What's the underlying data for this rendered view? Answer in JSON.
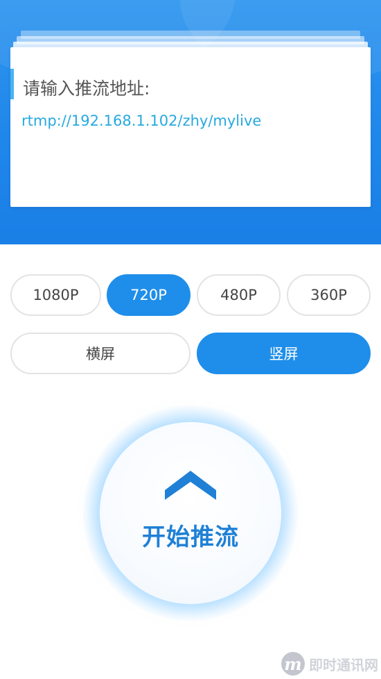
{
  "colors": {
    "header_blue": "#1f86ea",
    "accent_blue": "#1f8eea",
    "url_color": "#26a9df",
    "start_label_color": "#1f80d6"
  },
  "url_card": {
    "label": "请输入推流地址:",
    "url": "rtmp://192.168.1.102/zhy/mylive"
  },
  "resolution_options": [
    {
      "label": "1080P",
      "selected": false
    },
    {
      "label": "720P",
      "selected": true
    },
    {
      "label": "480P",
      "selected": false
    },
    {
      "label": "360P",
      "selected": false
    }
  ],
  "orientation_options": [
    {
      "label": "横屏",
      "selected": false
    },
    {
      "label": "竖屏",
      "selected": true
    }
  ],
  "start_button": {
    "icon": "chevron-up-icon",
    "label": "开始推流"
  },
  "watermark": {
    "logo": "m",
    "text": "即时通讯网"
  }
}
